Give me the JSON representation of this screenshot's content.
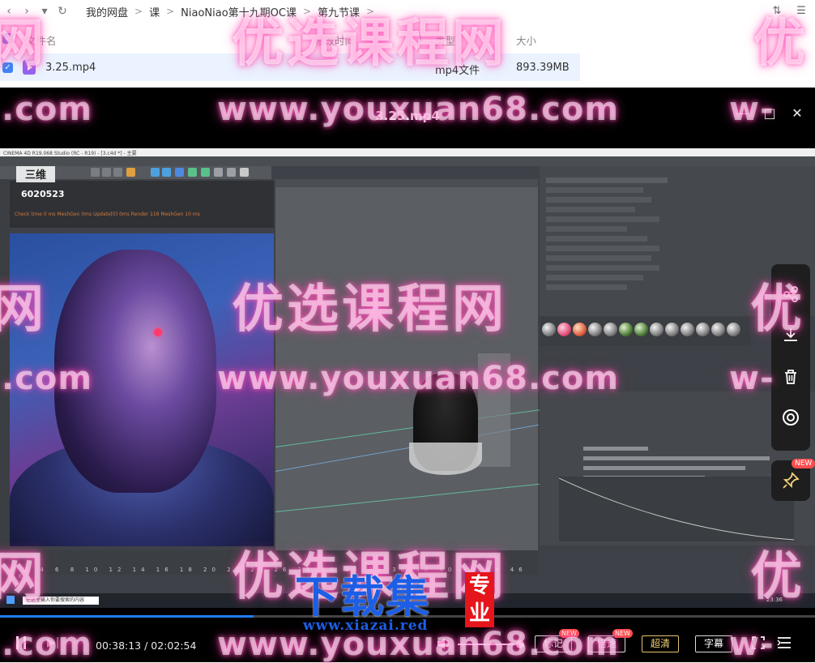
{
  "browser": {
    "nav": {
      "back": "‹",
      "forward": "›",
      "dropdown": "▾",
      "refresh": "↻"
    },
    "breadcrumbs": [
      "我的网盘",
      "课",
      "NiaoNiao第十九期OC课",
      "第九节课"
    ],
    "sep": ">",
    "columns": {
      "name": "文件名",
      "modified": "修改时间",
      "type": "类型",
      "size": "大小"
    },
    "file": {
      "name": "3.25.mp4",
      "type": "mp4文件",
      "size": "893.39MB"
    }
  },
  "player": {
    "title": "3.25.mp4",
    "window": {
      "minimize": "—",
      "maximize": "□",
      "close": "✕"
    },
    "video": {
      "app_title": "CINEMA 4D R19.068 Studio (RC - R19) - [3.c4d *] - 主要",
      "logo_number": "6020523",
      "render_info": "Check time 0 ms  MeshGen 0ms  Update[0] 0ms  Render 116 MeshGen 10 ms",
      "timeline_numbers": "0 2 4 6 8 10 12 14 16 18 20 22 24 26 28 30 32 34 36 38 40 42 44 46 48",
      "task_search": "在这里输入你要搜索的内容",
      "tray_time": "23:36"
    },
    "side_tools": {
      "share": "share-icon",
      "download": "download-icon",
      "delete": "trash-icon",
      "target": "target-icon",
      "pin": "pin-icon",
      "pin_badge": "NEW"
    },
    "progress": {
      "current_seconds": 2293,
      "total_seconds": 7374
    },
    "time_display": "00:38:13 / 02:02:54",
    "buttons": {
      "mark": "标记",
      "mark_badge": "NEW",
      "speed": "倍速",
      "speed_badge": "NEW",
      "quality": "超清",
      "subtitle": "字幕"
    },
    "colors": {
      "accent": "#1f7cff",
      "quality": "#f5d27a",
      "badge": "#ff4d4f"
    }
  },
  "watermarks": {
    "text": "优选课程网",
    "url": "www.youxuan68.com",
    "url_fragment": ".com",
    "url_left_cut": "w-",
    "big_right_cut": "优",
    "big_left_cut": "网"
  },
  "logo": {
    "text": "下载集",
    "badge": "专业",
    "url": "www.xiazai.red"
  }
}
